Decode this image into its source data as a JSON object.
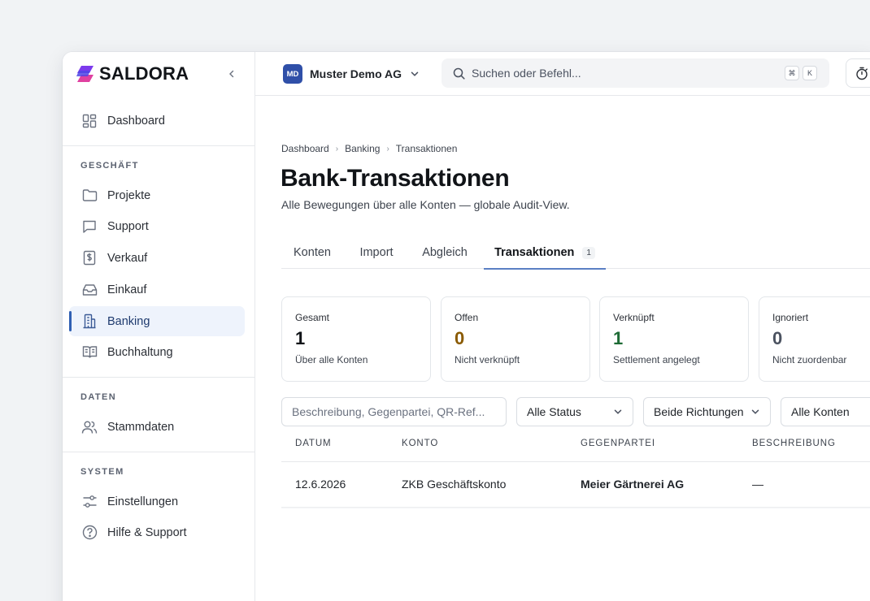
{
  "brand": {
    "name": "SALDORA"
  },
  "sidebar": {
    "dashboard": "Dashboard",
    "sections": {
      "geschaeft": "GESCHÄFT",
      "daten": "DATEN",
      "system": "SYSTEM"
    },
    "items": [
      {
        "label": "Projekte",
        "icon": "folder-icon"
      },
      {
        "label": "Support",
        "icon": "chat-icon"
      },
      {
        "label": "Verkauf",
        "icon": "dollar-doc-icon"
      },
      {
        "label": "Einkauf",
        "icon": "inbox-icon"
      },
      {
        "label": "Banking",
        "icon": "building-icon",
        "active": true
      },
      {
        "label": "Buchhaltung",
        "icon": "book-icon"
      },
      {
        "label": "Stammdaten",
        "icon": "users-icon"
      },
      {
        "label": "Einstellungen",
        "icon": "sliders-icon"
      },
      {
        "label": "Hilfe & Support",
        "icon": "help-icon"
      }
    ]
  },
  "topbar": {
    "org_initials": "MD",
    "org_name": "Muster Demo AG",
    "search_placeholder": "Suchen oder Befehl...",
    "shortcut_keys": [
      "⌘",
      "K"
    ]
  },
  "breadcrumb": [
    "Dashboard",
    "Banking",
    "Transaktionen"
  ],
  "page": {
    "title": "Bank-Transaktionen",
    "subtitle": "Alle Bewegungen über alle Konten — globale Audit-View."
  },
  "tabs": [
    {
      "label": "Konten"
    },
    {
      "label": "Import"
    },
    {
      "label": "Abgleich"
    },
    {
      "label": "Transaktionen",
      "count": "1",
      "active": true
    }
  ],
  "stats": [
    {
      "label": "Gesamt",
      "value": "1",
      "sub": "Über alle Konten",
      "color": "#111418"
    },
    {
      "label": "Offen",
      "value": "0",
      "sub": "Nicht verknüpft",
      "color": "#8a5a00"
    },
    {
      "label": "Verknüpft",
      "value": "1",
      "sub": "Settlement angelegt",
      "color": "#1e6b35"
    },
    {
      "label": "Ignoriert",
      "value": "0",
      "sub": "Nicht zuordenbar",
      "color": "#4b5260"
    }
  ],
  "filters": {
    "search_placeholder": "Beschreibung, Gegenpartei, QR-Ref...",
    "status": "Alle Status",
    "direction": "Beide Richtungen",
    "accounts": "Alle Konten"
  },
  "table": {
    "columns": [
      "DATUM",
      "KONTO",
      "GEGENPARTEI",
      "BESCHREIBUNG"
    ],
    "rows": [
      {
        "datum": "12.6.2026",
        "konto": "ZKB Geschäftskonto",
        "gegenpartei": "Meier Gärtnerei AG",
        "beschreibung": "—"
      }
    ]
  },
  "colors": {
    "accent": "#2f5fb3",
    "active_bg": "#eef3fc"
  }
}
